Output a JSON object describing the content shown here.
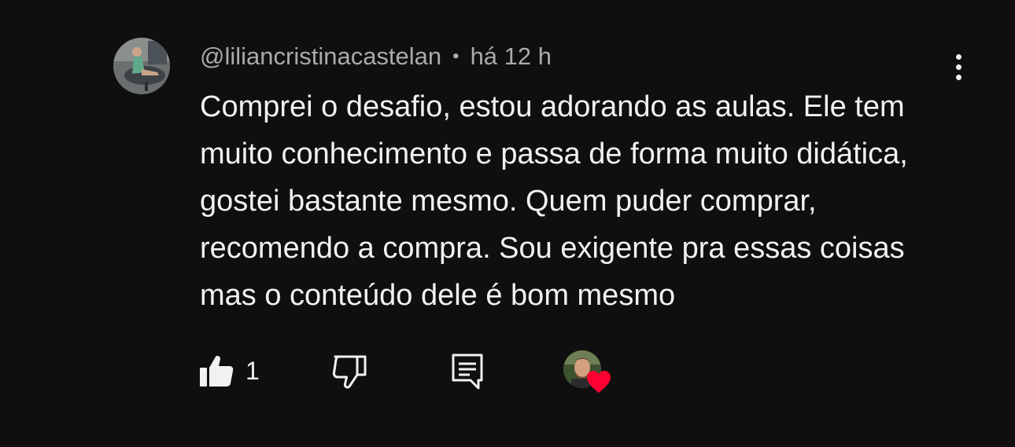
{
  "comment": {
    "author_handle": "@liliancristinacastelan",
    "separator": "•",
    "timestamp": "há 12 h",
    "text": "Comprei o desafio, estou adorando as aulas. Ele tem muito conhecimento e passa de forma muito didática, gostei bastante mesmo. Quem puder comprar, recomendo a compra. Sou exigente pra essas coisas mas o conteúdo dele é bom mesmo",
    "like_count": "1"
  },
  "icons": {
    "more": "more-vert-icon",
    "like": "thumb-up-filled-icon",
    "dislike": "thumb-down-outline-icon",
    "reply": "comment-reply-icon",
    "creator_heart": "heart-icon"
  },
  "colors": {
    "background": "#0f0f0f",
    "text_primary": "#f1f1f1",
    "text_secondary": "#aaaaaa",
    "heart": "#ff0033"
  }
}
